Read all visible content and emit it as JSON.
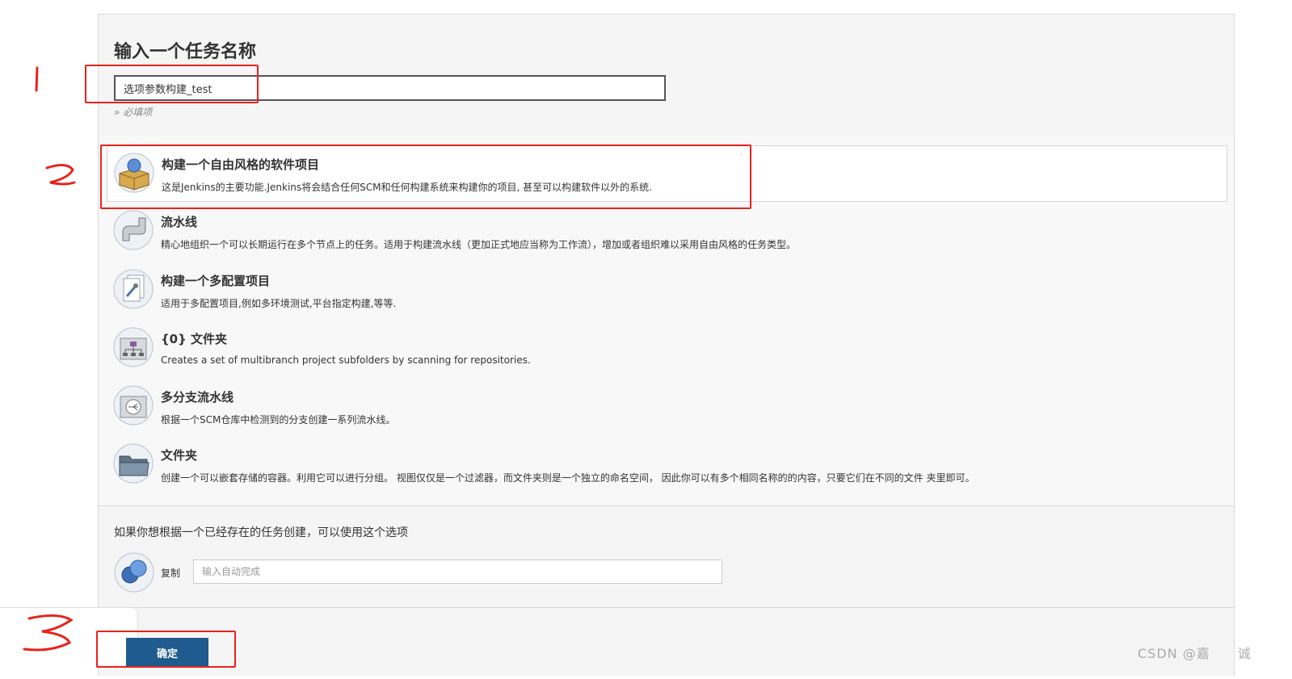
{
  "form": {
    "title": "输入一个任务名称",
    "name_value": "选项参数构建_test",
    "required_hint": "» 必填项"
  },
  "item_types": [
    {
      "name": "构建一个自由风格的软件项目",
      "desc": "这是Jenkins的主要功能.Jenkins将会结合任何SCM和任何构建系统来构建你的项目, 甚至可以构建软件以外的系统.",
      "icon": "freestyle-box-icon",
      "selected": true
    },
    {
      "name": "流水线",
      "desc": "精心地组织一个可以长期运行在多个节点上的任务。适用于构建流水线（更加正式地应当称为工作流），增加或者组织难以采用自由风格的任务类型。",
      "icon": "pipeline-icon"
    },
    {
      "name": "构建一个多配置项目",
      "desc": "适用于多配置项目,例如多环境测试,平台指定构建,等等.",
      "icon": "multiconfig-icon"
    },
    {
      "name": "{0} 文件夹",
      "desc": "Creates a set of multibranch project subfolders by scanning for repositories.",
      "icon": "org-folder-icon"
    },
    {
      "name": "多分支流水线",
      "desc": "根据一个SCM仓库中检测到的分支创建一系列流水线。",
      "icon": "multibranch-icon"
    },
    {
      "name": "文件夹",
      "desc": "创建一个可以嵌套存储的容器。利用它可以进行分组。 视图仅仅是一个过滤器，而文件夹则是一个独立的命名空间， 因此你可以有多个相同名称的的内容，只要它们在不同的文件 夹里即可。",
      "icon": "folder-icon"
    }
  ],
  "copy": {
    "hint": "如果你想根据一个已经存在的任务创建，可以使用这个选项",
    "label": "复制",
    "placeholder": "输入自动完成"
  },
  "buttons": {
    "ok": "确定"
  },
  "watermark": "CSDN @嘉　　诚",
  "colors": {
    "annotation_red": "#e8221c",
    "ok_button": "#1f5b8f"
  }
}
